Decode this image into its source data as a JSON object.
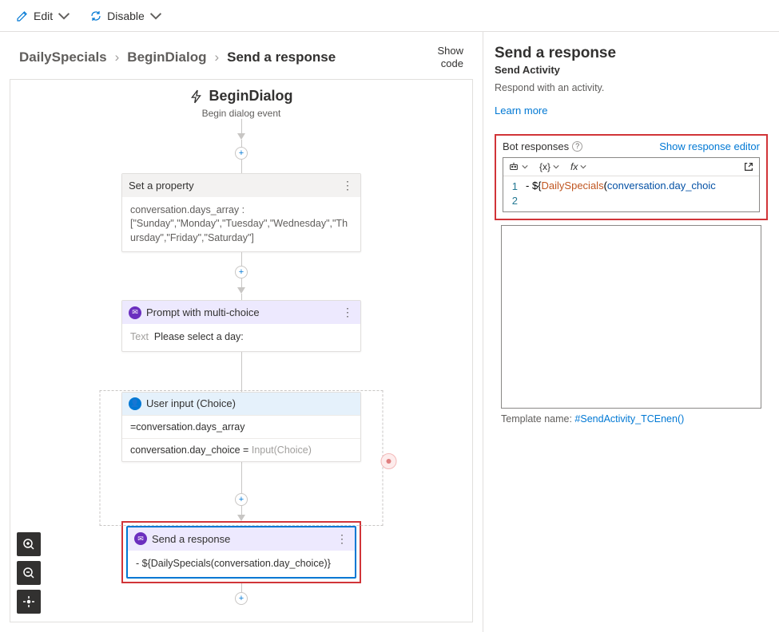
{
  "toolbar": {
    "edit_label": "Edit",
    "disable_label": "Disable"
  },
  "breadcrumb": {
    "items": [
      "DailySpecials",
      "BeginDialog",
      "Send a response"
    ]
  },
  "show_code_label": "Show code",
  "flow": {
    "trigger_title": "BeginDialog",
    "trigger_subtitle": "Begin dialog event",
    "set_property": {
      "title": "Set a property",
      "body": "conversation.days_array : [\"Sunday\",\"Monday\",\"Tuesday\",\"Wednesday\",\"Thursday\",\"Friday\",\"Saturday\"]"
    },
    "prompt": {
      "title": "Prompt with multi-choice",
      "text_label": "Text",
      "text_value": "Please select a day:"
    },
    "user_input": {
      "title": "User input (Choice)",
      "row1": "=conversation.days_array",
      "row2_prefix": "conversation.day_choice = ",
      "row2_value": "Input(Choice)"
    },
    "send_response": {
      "title": "Send a response",
      "body": "- ${DailySpecials(conversation.day_choice)}"
    }
  },
  "details": {
    "title": "Send a response",
    "kind": "Send Activity",
    "description": "Respond with an activity.",
    "learn_more": "Learn more",
    "bot_responses_label": "Bot responses",
    "show_editor_link": "Show response editor",
    "template_name_label": "Template name: ",
    "template_name_value": "#SendActivity_TCEnen()",
    "editor": {
      "line_1_prefix": "- ",
      "line_1_fn": "DailySpecials",
      "line_1_arg": "conversation.day_choic",
      "lines": [
        "1",
        "2"
      ]
    },
    "tools": {
      "braces": "{x}",
      "fx": "fx"
    }
  }
}
